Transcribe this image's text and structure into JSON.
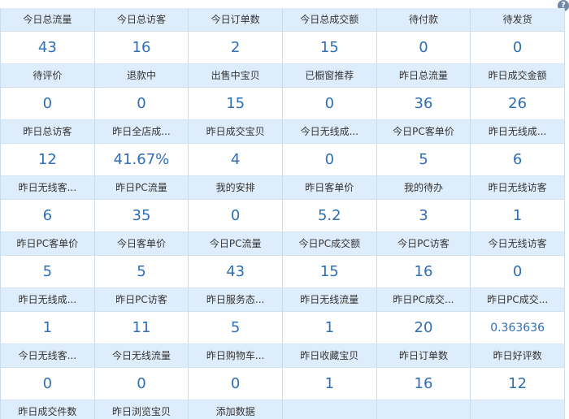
{
  "help_icon": "question-mark-icon",
  "rows": [
    {
      "kind": "label",
      "cells": [
        "今日总流量",
        "今日总访客",
        "今日订单数",
        "今日总成交额",
        "待付款",
        "待发货"
      ]
    },
    {
      "kind": "value",
      "cells": [
        "43",
        "16",
        "2",
        "15",
        "0",
        "0"
      ]
    },
    {
      "kind": "label",
      "cells": [
        "待评价",
        "退款中",
        "出售中宝贝",
        "已橱窗推荐",
        "昨日总流量",
        "昨日成交金额"
      ]
    },
    {
      "kind": "value",
      "cells": [
        "0",
        "0",
        "15",
        "0",
        "36",
        "26"
      ]
    },
    {
      "kind": "label",
      "cells": [
        "昨日总访客",
        "昨日全店成...",
        "昨日成交宝贝",
        "今日无线成...",
        "今日PC客单价",
        "昨日无线成..."
      ]
    },
    {
      "kind": "value",
      "cells": [
        "12",
        "41.67%",
        "4",
        "0",
        "5",
        "6"
      ]
    },
    {
      "kind": "label",
      "cells": [
        "昨日无线客...",
        "昨日PC流量",
        "我的安排",
        "昨日客单价",
        "我的待办",
        "昨日无线访客"
      ]
    },
    {
      "kind": "value",
      "cells": [
        "6",
        "35",
        "0",
        "5.2",
        "3",
        "1"
      ]
    },
    {
      "kind": "label",
      "cells": [
        "昨日PC客单价",
        "今日客单价",
        "今日PC流量",
        "今日PC成交额",
        "今日PC访客",
        "今日无线访客"
      ]
    },
    {
      "kind": "value",
      "cells": [
        "5",
        "5",
        "43",
        "15",
        "16",
        "0"
      ]
    },
    {
      "kind": "label",
      "cells": [
        "昨日无线成...",
        "昨日PC访客",
        "昨日服务态...",
        "昨日无线流量",
        "昨日PC成交...",
        "昨日PC成交..."
      ]
    },
    {
      "kind": "value",
      "cells": [
        "1",
        "11",
        "5",
        "1",
        "20",
        "0.363636"
      ]
    },
    {
      "kind": "label",
      "cells": [
        "今日无线客...",
        "今日无线流量",
        "昨日购物车...",
        "昨日收藏宝贝",
        "昨日订单数",
        "昨日好评数"
      ]
    },
    {
      "kind": "value",
      "cells": [
        "0",
        "0",
        "0",
        "1",
        "16",
        "12"
      ]
    },
    {
      "kind": "label",
      "cells": [
        "昨日成交件数",
        "昨日浏览宝贝",
        "添加数据",
        "",
        "",
        ""
      ]
    }
  ]
}
